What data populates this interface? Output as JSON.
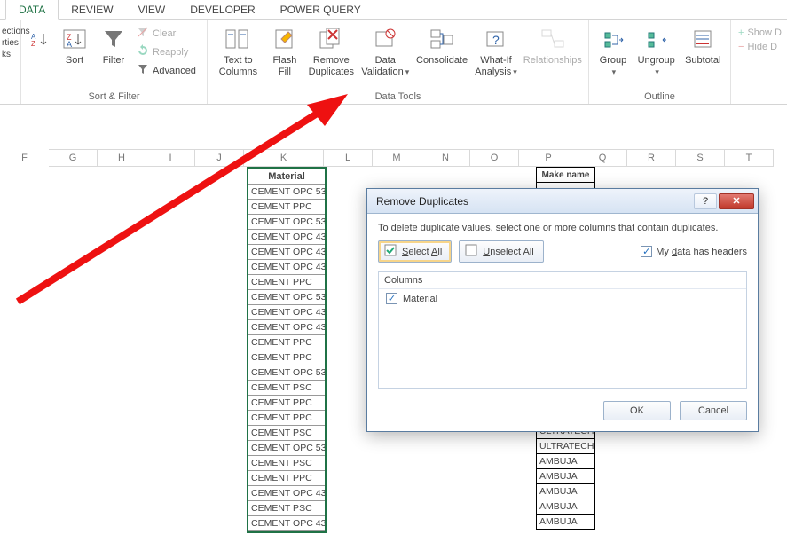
{
  "tabs": {
    "data": "DATA",
    "review": "REVIEW",
    "view": "VIEW",
    "developer": "DEVELOPER",
    "pq": "POWER QUERY"
  },
  "left_stubs": {
    "a": "ections",
    "b": "rties",
    "c": "ks"
  },
  "ribbon": {
    "sort": "Sort",
    "filter": "Filter",
    "clear": "Clear",
    "reapply": "Reapply",
    "advanced": "Advanced",
    "sortfilter_group": "Sort & Filter",
    "t2c_l1": "Text to",
    "t2c_l2": "Columns",
    "ff_l1": "Flash",
    "ff_l2": "Fill",
    "rd_l1": "Remove",
    "rd_l2": "Duplicates",
    "dv_l1": "Data",
    "dv_l2": "Validation",
    "consolidate": "Consolidate",
    "wi_l1": "What-If",
    "wi_l2": "Analysis",
    "relationships": "Relationships",
    "datatools_group": "Data Tools",
    "group": "Group",
    "ungroup": "Ungroup",
    "subtotal": "Subtotal",
    "outline_group": "Outline",
    "showd": "Show D",
    "hided": "Hide D"
  },
  "cols": {
    "F": "F",
    "G": "G",
    "H": "H",
    "I": "I",
    "J": "J",
    "K": "K",
    "L": "L",
    "M": "M",
    "N": "N",
    "O": "O",
    "P": "P",
    "Q": "Q",
    "R": "R",
    "S": "S",
    "T": "T"
  },
  "k_header": "Material",
  "k_data": [
    "CEMENT OPC 53",
    "CEMENT PPC",
    "CEMENT OPC 53",
    "CEMENT OPC 43",
    "CEMENT OPC 43",
    "CEMENT OPC 43",
    "CEMENT PPC",
    "CEMENT OPC 53",
    "CEMENT OPC 43",
    "CEMENT OPC 43",
    "CEMENT PPC",
    "CEMENT PPC",
    "CEMENT OPC 53",
    "CEMENT PSC",
    "CEMENT PPC",
    "CEMENT PPC",
    "CEMENT PSC",
    "CEMENT OPC 53",
    "CEMENT PSC",
    "CEMENT PPC",
    "CEMENT OPC 43",
    "CEMENT PSC",
    "CEMENT OPC 43"
  ],
  "p_header": "Make name",
  "p_data_tail": [
    "ULTRATECH",
    "ULTRATECH",
    "ULTRATECH",
    "AMBUJA",
    "AMBUJA",
    "AMBUJA",
    "AMBUJA",
    "AMBUJA"
  ],
  "dialog": {
    "title": "Remove Duplicates",
    "intro": "To delete duplicate values, select one or more columns that contain duplicates.",
    "select_all": "Select All",
    "unselect_all": "Unselect All",
    "headers_label_pre": "My ",
    "headers_label_u": "d",
    "headers_label_post": "ata has headers",
    "cols_label": "Columns",
    "col_item": "Material",
    "ok": "OK",
    "cancel": "Cancel"
  }
}
